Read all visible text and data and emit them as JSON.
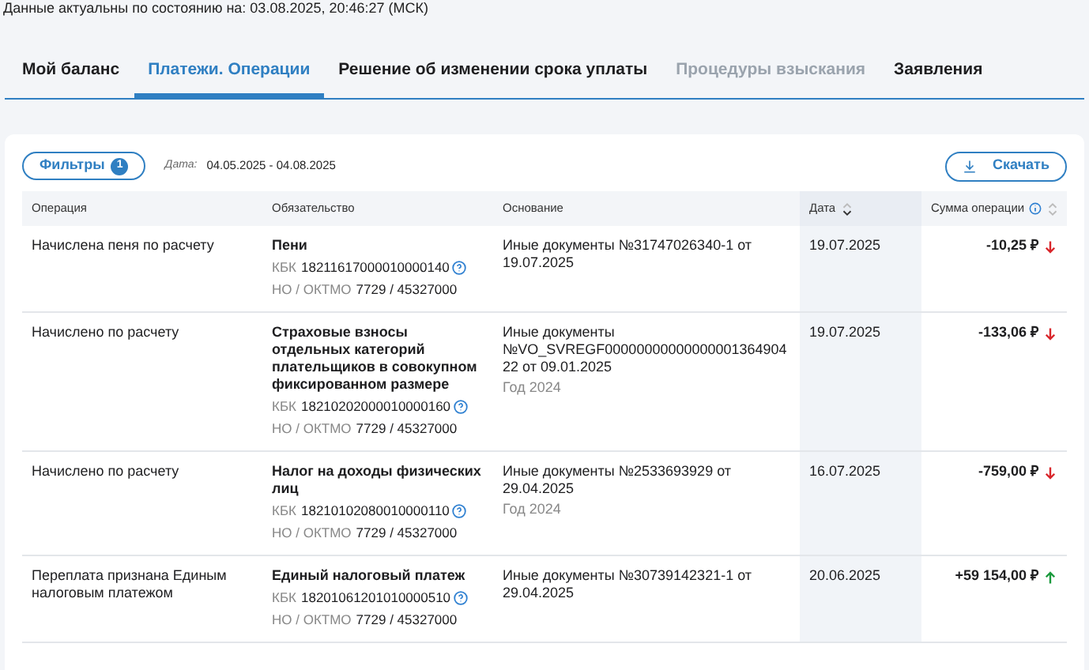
{
  "status_line": "Данные актуальны по состоянию на: 03.08.2025, 20:46:27 (МСК)",
  "tabs": [
    {
      "label": "Мой баланс",
      "selected": false,
      "disabled": false
    },
    {
      "label": "Платежи. Операции",
      "selected": true,
      "disabled": false
    },
    {
      "label": "Решение об изменении срока уплаты",
      "selected": false,
      "disabled": false
    },
    {
      "label": "Процедуры взыскания",
      "selected": false,
      "disabled": true
    },
    {
      "label": "Заявления",
      "selected": false,
      "disabled": false
    }
  ],
  "toolbar": {
    "filters_button": "Фильтры",
    "filters_count": "1",
    "date_label": "Дата:",
    "date_range": "04.05.2025 - 04.08.2025",
    "download_button": "Скачать"
  },
  "table": {
    "columns": [
      {
        "label": "Операция",
        "sortable": false,
        "info": false
      },
      {
        "label": "Обязательство",
        "sortable": false,
        "info": false
      },
      {
        "label": "Основание",
        "sortable": false,
        "info": false
      },
      {
        "label": "Дата",
        "sortable": true,
        "info": false
      },
      {
        "label": "Сумма операции",
        "sortable": true,
        "info": true
      }
    ],
    "rows": [
      {
        "operation": "Начислена пеня по расчету",
        "obligation": "Пени",
        "kbk_label": "КБК",
        "kbk": "18211617000010000140",
        "no_oktmo_label": "НО / ОКТМО",
        "no_oktmo": "7729 / 45327000",
        "basis": "Иные документы №31747026340-1 от 19.07.2025",
        "date": "19.07.2025",
        "amount": "-10,25 ₽",
        "kind": "debit"
      },
      {
        "operation": "Начислено по расчету",
        "obligation": "Страховые взносы отдельных категорий плательщиков в совокупном фиксированном размере",
        "kbk_label": "КБК",
        "kbk": "18210202000010000160",
        "no_oktmo_label": "НО / ОКТМО",
        "no_oktmo": "7729 / 45327000",
        "basis": "Иные документы №VO_SVREGF0000000000000000136490422 от 09.01.2025",
        "year": "Год 2024",
        "date": "19.07.2025",
        "amount": "-133,06 ₽",
        "kind": "debit"
      },
      {
        "operation": "Начислено по расчету",
        "obligation": "Налог на доходы физических лиц",
        "kbk_label": "КБК",
        "kbk": "18210102080010000110",
        "no_oktmo_label": "НО / ОКТМО",
        "no_oktmo": "7729 / 45327000",
        "basis": "Иные документы №2533693929 от 29.04.2025",
        "year": "Год 2024",
        "date": "16.07.2025",
        "amount": "-759,00 ₽",
        "kind": "debit"
      },
      {
        "operation": "Переплата признана Единым налоговым платежом",
        "obligation": "Единый налоговый платеж",
        "kbk_label": "КБК",
        "kbk": "18201061201010000510",
        "no_oktmo_label": "НО / ОКТМО",
        "no_oktmo": "7729 / 45327000",
        "basis": "Иные документы №30739142321-1 от 29.04.2025",
        "date": "20.06.2025",
        "amount": "+59 154,00 ₽",
        "kind": "credit"
      }
    ]
  }
}
